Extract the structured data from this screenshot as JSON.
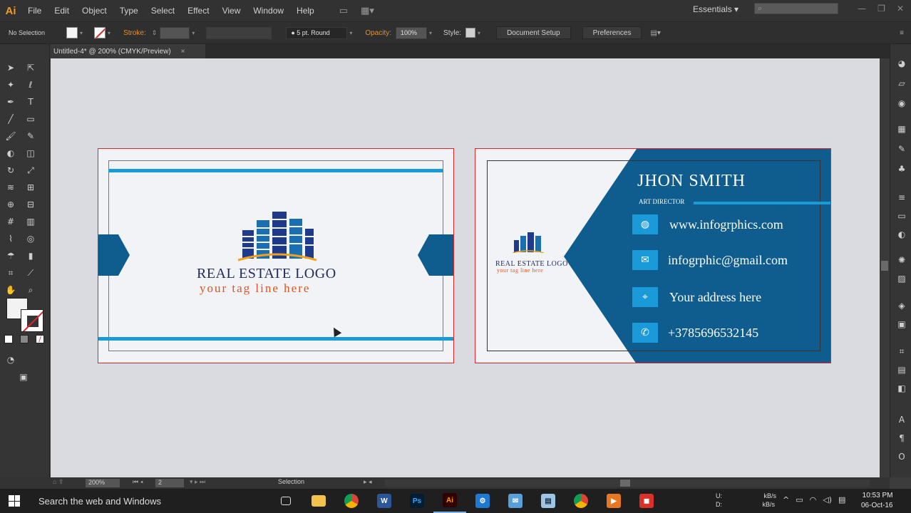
{
  "app": {
    "logo": "Ai",
    "menu": [
      "File",
      "Edit",
      "Object",
      "Type",
      "Select",
      "Effect",
      "View",
      "Window",
      "Help"
    ],
    "workspace": "Essentials",
    "search_placeholder": ""
  },
  "control_bar": {
    "selection": "No Selection",
    "stroke_label": "Stroke:",
    "brush": "5 pt. Round",
    "opacity_label": "Opacity:",
    "opacity_value": "100%",
    "style_label": "Style:",
    "document_setup": "Document Setup",
    "preferences": "Preferences"
  },
  "document": {
    "tab_title": "Untitled-4* @ 200% (CMYK/Preview)",
    "close": "×"
  },
  "front_card": {
    "title": "REAL ESTATE LOGO",
    "tagline": "your tag line here"
  },
  "back_card": {
    "logo_title": "REAL ESTATE LOGO",
    "logo_tagline": "your tag line here",
    "name": "JHON SMITH",
    "role": "ART DIRECTOR",
    "website": "www.infogrphics.com",
    "email": "infogrphic@gmail.com",
    "address": "Your address here",
    "phone": "+3785696532145"
  },
  "status_bar": {
    "zoom": "200%",
    "page": "2",
    "tool": "Selection"
  },
  "taskbar": {
    "search": "Search the web and Windows",
    "time": "10:53 PM",
    "date": "06-Oct-16",
    "net_up": "U:",
    "net_down": "D:",
    "rate": "kB/s"
  },
  "colors": {
    "accent_blue": "#0f5c8e",
    "cyan": "#1a9ad8",
    "logo_navy": "#1e2a5c",
    "tagline_orange": "#e0531e",
    "ai_orange": "#f79a1e"
  }
}
